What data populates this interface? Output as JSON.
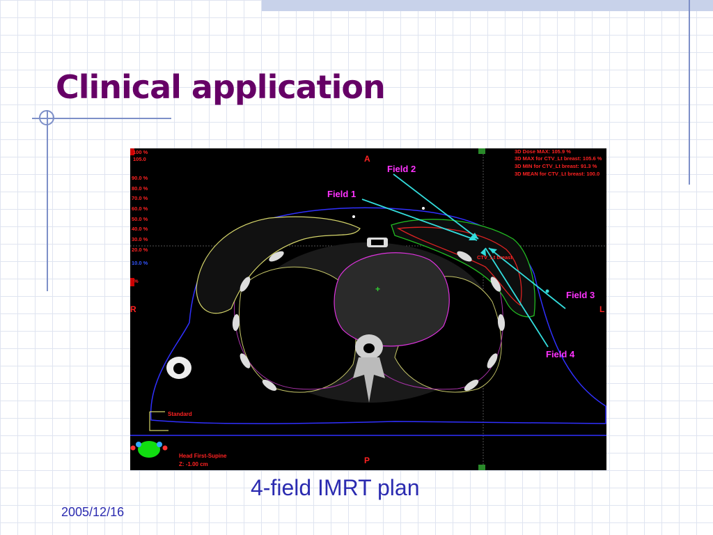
{
  "slide": {
    "title": "Clinical application",
    "caption": "4-field IMRT plan",
    "date": "2005/12/16"
  },
  "image": {
    "orientation": {
      "anterior": "A",
      "posterior": "P",
      "right": "R",
      "left": "L"
    },
    "fields": [
      {
        "label": "Field 1"
      },
      {
        "label": "Field 2"
      },
      {
        "label": "Field 3"
      },
      {
        "label": "Field 4"
      }
    ],
    "target_label": "CTV_Lt breast",
    "dose_legend": [
      "105.0",
      "90.0 %",
      "80.0 %",
      "70.0 %",
      "60.0 %",
      "50.0 %",
      "40.0 %",
      "30.0 %",
      "20.0 %",
      "10.0 %"
    ],
    "dose_stats": [
      "3D Dose MAX: 105.9 %",
      "3D MAX for CTV_Lt breast: 105.6 %",
      "3D MIN for CTV_Lt breast: 91.3 %",
      "3D MEAN for CTV_Lt breast: 100.0"
    ],
    "window_preset": "Standard",
    "patient_position": "Head First-Supine",
    "slice_position": "Z: -1.00 cm",
    "colors": {
      "field_label": "#ff33ff",
      "beam": "#33dddd",
      "orientation": "#ff2222",
      "dose_text": "#ff2222"
    }
  }
}
